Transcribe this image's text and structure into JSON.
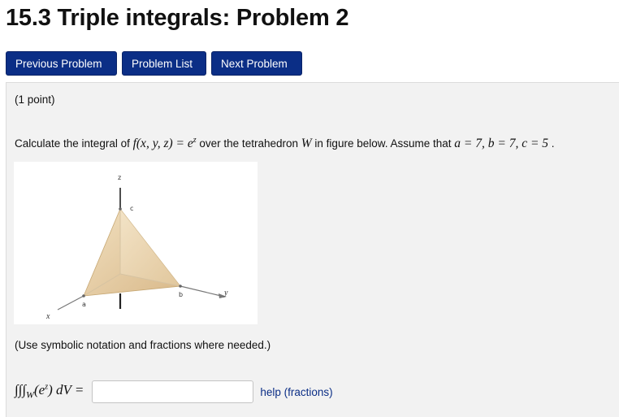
{
  "page": {
    "title": "15.3 Triple integrals: Problem 2"
  },
  "nav": {
    "previous": "Previous Problem",
    "list": "Problem List",
    "next": "Next Problem"
  },
  "problem": {
    "points": "(1 point)",
    "question_prefix": "Calculate the integral of ",
    "question_func": "f(x, y, z) = e",
    "question_exp": "z",
    "question_middle": " over the tetrahedron ",
    "question_region": "W",
    "question_suffix": " in figure below. Assume that ",
    "question_params": "a = 7, b = 7, c = 5",
    "question_end": " .",
    "hint": "(Use symbolic notation and fractions where needed.)"
  },
  "figure": {
    "axis_x": "x",
    "axis_y": "y",
    "axis_z": "z",
    "label_a": "a",
    "label_b": "b",
    "label_c": "c"
  },
  "answer": {
    "integral_lhs": "∫∫∫",
    "integral_sub": "W",
    "integrand": "(e",
    "integrand_exp": "z",
    "integrand_end": ") dV =",
    "value": "",
    "placeholder": "",
    "help_link": "help (fractions)"
  },
  "colors": {
    "button_bg": "#0b2e86",
    "panel_bg": "#f2f2f2",
    "link": "#0b2e86",
    "tetra_fill": "#e3c89a"
  }
}
